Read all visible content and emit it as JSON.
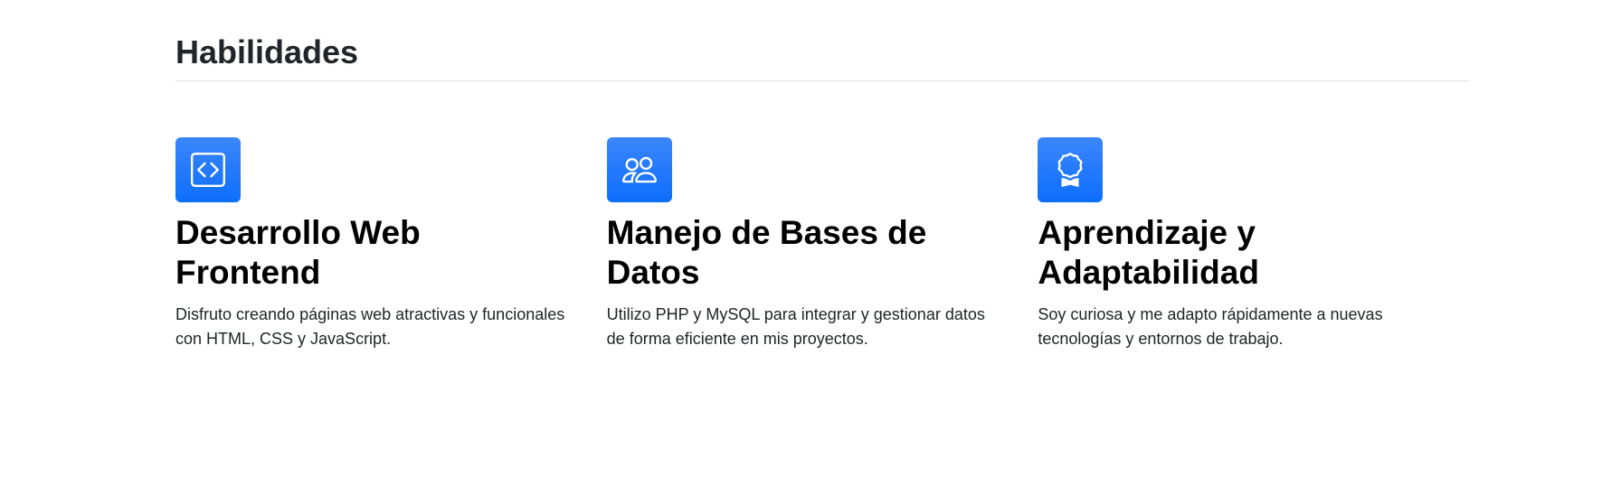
{
  "section": {
    "title": "Habilidades"
  },
  "features": [
    {
      "icon": "code-square-icon",
      "title": "Desarrollo Web Frontend",
      "text": "Disfruto creando páginas web atractivas y funcionales con HTML, CSS y JavaScript."
    },
    {
      "icon": "people-icon",
      "title": "Manejo de Bases de Datos",
      "text": "Utilizo PHP y MySQL para integrar y gestionar datos de forma eficiente en mis proyectos."
    },
    {
      "icon": "award-icon",
      "title": "Aprendizaje y Adaptabilidad",
      "text": "Soy curiosa y me adapto rápidamente a nuevas tecnologías y entornos de trabajo."
    }
  ],
  "colors": {
    "accent": "#0d6efd",
    "heading": "#212529",
    "divider": "#dee2e6"
  }
}
